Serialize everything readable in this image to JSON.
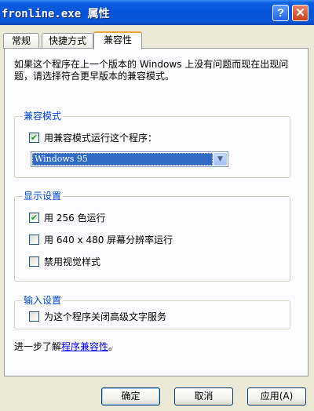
{
  "window": {
    "title": "fronline.exe 属性"
  },
  "title_buttons": {
    "help": "?",
    "close": "✕"
  },
  "tabs": [
    {
      "label": "常规",
      "active": false
    },
    {
      "label": "快捷方式",
      "active": false
    },
    {
      "label": "兼容性",
      "active": true
    }
  ],
  "intro": "如果这个程序在上一个版本的 Windows 上没有问题而现在出现问题，请选择符合更早版本的兼容模式。",
  "compat_mode": {
    "title": "兼容模式",
    "checkbox_label": "用兼容模式运行这个程序：",
    "checked": true,
    "selected_os": "Windows 95"
  },
  "display": {
    "title": "显示设置",
    "options": [
      {
        "label": "用 256 色运行",
        "checked": true
      },
      {
        "label": "用 640 x 480 屏幕分辨率运行",
        "checked": false
      },
      {
        "label": "禁用视觉样式",
        "checked": false
      }
    ]
  },
  "input": {
    "title": "输入设置",
    "option": {
      "label": "为这个程序关闭高级文字服务",
      "checked": false
    }
  },
  "learn_more": {
    "prefix": "进一步了解",
    "link": "程序兼容性",
    "suffix": "。"
  },
  "buttons": {
    "ok": "确定",
    "cancel": "取消",
    "apply": "应用(A)"
  },
  "colors": {
    "titlebar": "#0553d8",
    "group_title": "#0046d5",
    "link": "#0000ff",
    "selection": "#316ac5",
    "active_tab_accent": "#f1a43b"
  }
}
